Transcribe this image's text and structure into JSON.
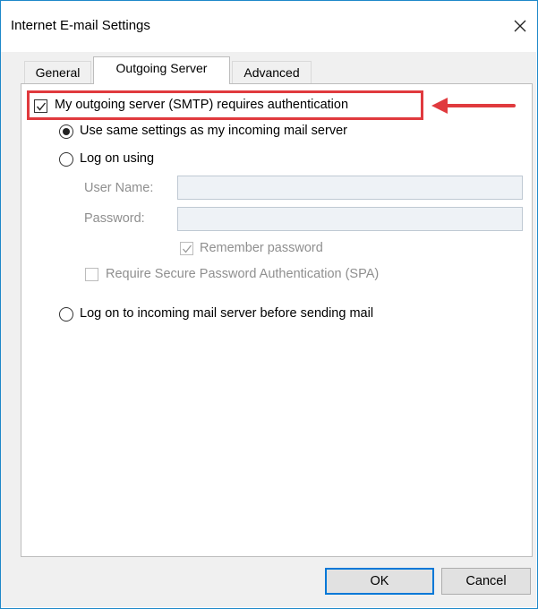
{
  "window": {
    "title": "Internet E-mail Settings",
    "close_icon": "close-icon"
  },
  "tabs": [
    {
      "label": "General",
      "selected": false
    },
    {
      "label": "Outgoing Server",
      "selected": true
    },
    {
      "label": "Advanced",
      "selected": false
    }
  ],
  "outgoing": {
    "requires_auth_label": "My outgoing server (SMTP) requires authentication",
    "requires_auth_checked": true,
    "option_same_settings": "Use same settings as my incoming mail server",
    "option_same_selected": true,
    "option_log_on_using": "Log on using",
    "user_name_label": "User Name:",
    "user_name_value": "",
    "password_label": "Password:",
    "password_value": "",
    "remember_password_label": "Remember password",
    "remember_password_checked": true,
    "spa_label": "Require Secure Password Authentication (SPA)",
    "spa_checked": false,
    "option_log_on_incoming": "Log on to incoming mail server before sending mail"
  },
  "buttons": {
    "ok": "OK",
    "cancel": "Cancel"
  },
  "annotation": {
    "highlight_color": "#e03a3e"
  },
  "colors": {
    "accent": "#0078d7",
    "window_border": "#1e88c9"
  }
}
